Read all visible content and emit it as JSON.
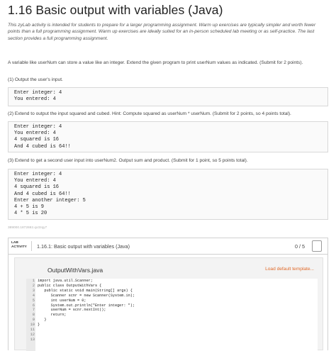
{
  "header": {
    "title": "1.16 Basic output with variables (Java)"
  },
  "intro": "This zyLab activity is intended for students to prepare for a larger programming assignment. Warm up exercises are typically simpler and worth fewer points than a full programming assignment. Warm up exercises are ideally suited for an in-person scheduled lab meeting or as self-practice. The last section provides a full programming assignment.",
  "instructions": {
    "p1": "A variable like userNum can store a value like an integer. Extend the given program to print userNum values as indicated. (Submit for 2 points).",
    "step1": "(1) Output the user's input.",
    "code1": "Enter integer: 4\nYou entered: 4",
    "step2": "(2) Extend to output the input squared and cubed. Hint: Compute squared as userNum * userNum. (Submit for 2 points, so 4 points total).",
    "code2": "Enter integer: 4\nYou entered: 4\n4 squared is 16\nAnd 4 cubed is 64!!",
    "step3": "(3) Extend to get a second user input into userNum2. Output sum and product. (Submit for 1 point, so 5 points total).",
    "code3": "Enter integer: 4\nYou entered: 4\n4 squared is 16\nAnd 4 cubed is 64!!\nEnter another integer: 5\n4 + 5 is 9\n4 * 5 is 20"
  },
  "activity_id": "389000.1872692.qx3zqy7",
  "lab": {
    "tag_line1": "LAB",
    "tag_line2": "ACTIVITY",
    "title": "1.16.1: Basic output with variables (Java)",
    "score": "0 / 5"
  },
  "editor": {
    "file_name": "OutputWithVars.java",
    "load_default": "Load default template...",
    "line_numbers": [
      "1",
      "2",
      "3",
      "4",
      "5",
      "6",
      "7",
      "8",
      "9",
      "10",
      "11",
      "12",
      "13"
    ],
    "lines": [
      "import java.util.Scanner;",
      "",
      "public class OutputWithVars {",
      "   public static void main(String[] args) {",
      "      Scanner scnr = new Scanner(System.in);",
      "      int userNum = 0;",
      "",
      "      System.out.println(\"Enter integer: \");",
      "      userNum = scnr.nextInt();",
      "",
      "      return;",
      "   }",
      "}"
    ]
  },
  "colors": {
    "accent": "#e06a2a",
    "code_background": "#fafafa",
    "border": "#d0d0d0"
  }
}
